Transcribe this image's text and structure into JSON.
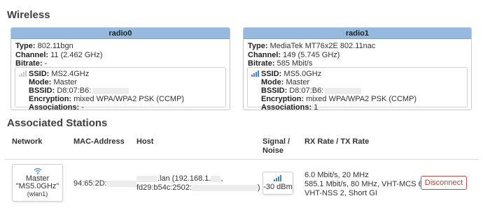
{
  "wireless": {
    "title": "Wireless",
    "radios": [
      {
        "name": "radio0",
        "type_label": "Type:",
        "type_value": "802.11bgn",
        "channel_label": "Channel:",
        "channel_value": "11 (2.462 GHz)",
        "bitrate_label": "Bitrate:",
        "bitrate_value": "-",
        "ssid_label": "SSID:",
        "ssid_value": "MS2.4GHz",
        "mode_label": "Mode:",
        "mode_value": "Master",
        "bssid_label": "BSSID:",
        "bssid_value": "D8:07:B6:",
        "enc_label": "Encryption:",
        "enc_value": "mixed WPA/WPA2 PSK (CCMP)",
        "assoc_label": "Associations:",
        "assoc_value": "-",
        "signal_active": false
      },
      {
        "name": "radio1",
        "type_label": "Type:",
        "type_value": "MediaTek MT76x2E 802.11nac",
        "channel_label": "Channel:",
        "channel_value": "149 (5.745 GHz)",
        "bitrate_label": "Bitrate:",
        "bitrate_value": "585 Mbit/s",
        "ssid_label": "SSID:",
        "ssid_value": "MS5.0GHz",
        "mode_label": "Mode:",
        "mode_value": "Master",
        "bssid_label": "BSSID:",
        "bssid_value": "D8:07:B6:",
        "enc_label": "Encryption:",
        "enc_value": "mixed WPA/WPA2 PSK (CCMP)",
        "assoc_label": "Associations:",
        "assoc_value": "1",
        "signal_active": true
      }
    ]
  },
  "stations": {
    "title": "Associated Stations",
    "headers": {
      "network": "Network",
      "mac": "MAC-Address",
      "host": "Host",
      "signal_line1": "Signal /",
      "signal_line2": "Noise",
      "rate": "RX Rate / TX Rate"
    },
    "rows": [
      {
        "network_mode": "Master",
        "network_ssid": "\"MS5.0GHz\"",
        "network_iface": "(wlan1)",
        "mac": "94:65:2D:",
        "host_line1_suffix": ".lan (192.168.1.",
        "host_line1_end": ",",
        "host_line2": "fd29:b54c:2502:",
        "host_line2_end": ")",
        "signal": "-30 dBm",
        "rate_line1": "6.0 Mbit/s, 20 MHz",
        "rate_line2": "585.1 Mbit/s, 80 MHz, VHT-MCS 6,",
        "rate_line3": "VHT-NSS 2, Short GI",
        "action_label": "Disconnect"
      }
    ]
  },
  "colors": {
    "radio_header_bg": "#96b9de",
    "signal_active": "#3e87d6",
    "disconnect": "#c0392b"
  },
  "icons": {
    "signal": "signal-strength-icon",
    "wifi": "wifi-icon"
  }
}
